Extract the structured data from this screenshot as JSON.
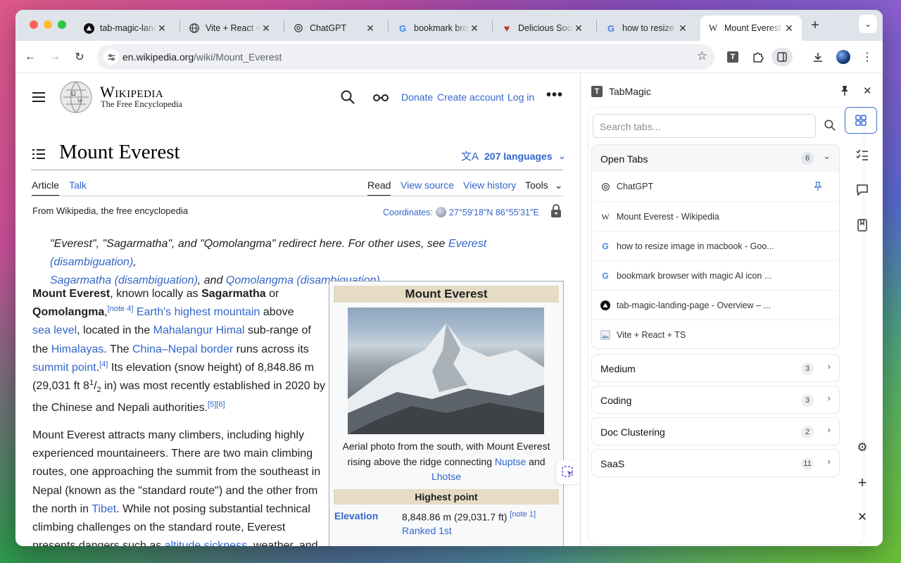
{
  "browser": {
    "tabs": [
      {
        "title": "tab-magic-landing-page",
        "icon": "triangle-logo-icon"
      },
      {
        "title": "Vite + React + TS",
        "icon": "globe-icon"
      },
      {
        "title": "ChatGPT",
        "icon": "chatgpt-icon"
      },
      {
        "title": "bookmark browser with magic AI icon",
        "icon": "google-icon"
      },
      {
        "title": "Delicious Social Bookmarking",
        "icon": "heart-icon"
      },
      {
        "title": "how to resize image in macbook",
        "icon": "google-icon"
      },
      {
        "title": "Mount Everest - Wikipedia",
        "icon": "wikipedia-icon"
      }
    ],
    "url_domain": "en.wikipedia.org",
    "url_path": "/wiki/Mount_Everest"
  },
  "wiki": {
    "wordmark": "Wikipedia",
    "tagline": "The Free Encyclopedia",
    "donate": "Donate",
    "create_account": "Create account",
    "login": "Log in",
    "title": "Mount Everest",
    "languages": "207 languages",
    "tab_article": "Article",
    "tab_talk": "Talk",
    "read": "Read",
    "view_source": "View source",
    "view_history": "View history",
    "tools": "Tools",
    "from": "From Wikipedia, the free encyclopedia",
    "coords_label": "Coordinates:",
    "coords": "27°59′18″N 86°55′31″E",
    "hatnote": {
      "intro": "\"Everest\", \"Sagarmatha\", and \"Qomolangma\" redirect here. For other uses, see ",
      "link1": "Everest (disambiguation)",
      "link2": "Sagarmatha (disambiguation)",
      "and": ", and ",
      "link3": "Qomolangma (disambiguation)"
    },
    "para1": {
      "l1_b": "Mount Everest",
      "l1_t1": ", known locally as ",
      "l1_b2": "Sagarmatha",
      "l1_t2": " or",
      "l2_b": "Qomolangma",
      "l2_t1": ",",
      "note4": "[note 4]",
      "l2_link": "Earth's highest mountain",
      "l2_t2": " above",
      "l3_link": "sea level",
      "l3_t": ", located in the ",
      "l3_link2": "Mahalangur Himal",
      "l3_t2": " sub-range of",
      "l4_t": "the ",
      "l4_link": "Himalayas",
      "l4_t2": ". The ",
      "l4_link2": "China–Nepal border",
      "l4_t3": " runs across its",
      "l5_link": "summit point",
      "l5_ref": "[4]",
      "l5_t": " Its elevation (snow height) of 8,848.86 m",
      "l6_t": "(29,031 ft 8",
      "l6_num": "1",
      "l6_den": "2",
      "l6_t2": " in) was most recently established in 2020 by",
      "l7_t": "the Chinese and Nepali authorities.",
      "l7_ref": "[5][6]"
    },
    "para2": {
      "l1": "Mount Everest attracts many climbers, including highly",
      "l2": "experienced mountaineers. There are two main climbing",
      "l3": "routes, one approaching the summit from the southeast in",
      "l4": "Nepal (known as the \"standard route\") and the other from",
      "l5_t": "the north in ",
      "l5_link": "Tibet",
      "l5_t2": ". While not posing substantial technical",
      "l6": "climbing challenges on the standard route, Everest",
      "l7_t": "presents dangers such as ",
      "l7_link": "altitude sickness",
      "l7_t2": ", weather, and"
    },
    "infobox": {
      "title": "Mount Everest",
      "caption_1": "Aerial photo from the south, with Mount Everest",
      "caption_2": "rising above the ridge connecting ",
      "caption_link1": "Nuptse",
      "caption_and": " and",
      "caption_link2": "Lhotse",
      "section": "Highest point",
      "elev_label": "Elevation",
      "elev_value": "8,848.86 m (29,031.7 ft)",
      "elev_note": "[note 1]",
      "ranked": "Ranked 1st"
    }
  },
  "panel": {
    "title": "TabMagic",
    "search_placeholder": "Search tabs...",
    "open_tabs": {
      "label": "Open Tabs",
      "count": "6",
      "items": [
        {
          "title": "ChatGPT",
          "icon": "chatgpt-icon",
          "pinned": true
        },
        {
          "title": "Mount Everest - Wikipedia",
          "icon": "wikipedia-icon"
        },
        {
          "title": "how to resize image in macbook - Goo...",
          "icon": "google-icon"
        },
        {
          "title": "bookmark browser with magic AI icon ...",
          "icon": "google-icon"
        },
        {
          "title": "tab-magic-landing-page - Overview – ...",
          "icon": "triangle-logo-icon"
        },
        {
          "title": "Vite + React + TS",
          "icon": "image-icon"
        }
      ]
    },
    "groups": [
      {
        "label": "Medium",
        "count": "3"
      },
      {
        "label": "Coding",
        "count": "3"
      },
      {
        "label": "Doc Clustering",
        "count": "2"
      },
      {
        "label": "SaaS",
        "count": "11"
      }
    ]
  },
  "colors": {
    "link": "#3366cc",
    "accent": "#3b6fd8"
  }
}
